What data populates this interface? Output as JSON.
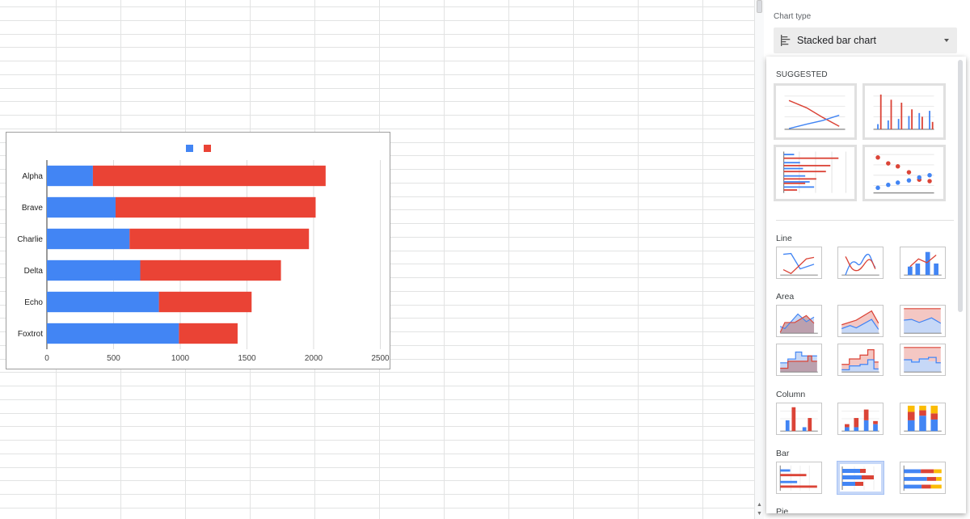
{
  "chart_data": {
    "type": "bar",
    "orientation": "horizontal",
    "stacked": true,
    "title": "",
    "xlabel": "",
    "ylabel": "",
    "categories": [
      "Alpha",
      "Brave",
      "Charlie",
      "Delta",
      "Echo",
      "Foxtrot"
    ],
    "series": [
      {
        "name": "",
        "color": "#4285f4",
        "values": [
          345,
          515,
          620,
          700,
          840,
          990
        ]
      },
      {
        "name": "",
        "color": "#ea4335",
        "values": [
          1745,
          1500,
          1345,
          1055,
          695,
          440
        ]
      }
    ],
    "xlim": [
      0,
      2500
    ],
    "xticks": [
      "0",
      "500",
      "1000",
      "1500",
      "2000",
      "2500"
    ],
    "grid": true,
    "legend": "top-center"
  },
  "sidebar": {
    "chart_type_label": "Chart type",
    "chart_type_value": "Stacked bar chart",
    "chart_type_icon": "stacked-bar-chart-icon",
    "dropdown": {
      "suggested_label": "SUGGESTED",
      "suggested": [
        "line-chart",
        "column-chart",
        "bar-chart",
        "scatter-chart"
      ],
      "sections": [
        {
          "label": "Line",
          "items": [
            "line-chart",
            "smooth-line-chart",
            "combo-chart"
          ]
        },
        {
          "label": "Area",
          "items": [
            "area-chart",
            "stacked-area-chart",
            "100-stacked-area-chart",
            "stepped-area-chart",
            "stacked-stepped-area-chart",
            "100-stacked-stepped-area-chart"
          ]
        },
        {
          "label": "Column",
          "items": [
            "column-chart",
            "stacked-column-chart",
            "100-stacked-column-chart"
          ]
        },
        {
          "label": "Bar",
          "items": [
            "bar-chart",
            "stacked-bar-chart",
            "100-stacked-bar-chart"
          ],
          "selected": "stacked-bar-chart"
        },
        {
          "label": "Pie",
          "items": []
        }
      ]
    }
  },
  "colors": {
    "blue": "#4285f4",
    "red": "#ea4335",
    "yellow": "#fbbc04"
  }
}
